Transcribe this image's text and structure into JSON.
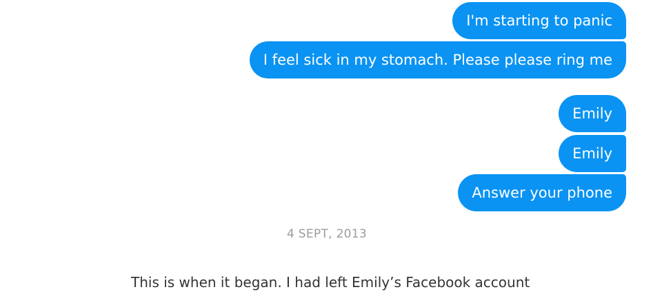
{
  "messages": [
    {
      "text": "I'm starting to panic"
    },
    {
      "text": "I feel sick in my stomach. Please please ring me"
    },
    {
      "text": "Emily"
    },
    {
      "text": "Emily"
    },
    {
      "text": "Answer your phone"
    }
  ],
  "timestamp": "4 SEPT, 2013",
  "caption": "This is when it began. I had left Emily’s Facebook account",
  "colors": {
    "bubble_background": "#0a93f3",
    "bubble_text": "#ffffff",
    "timestamp_text": "#9b9b9b",
    "caption_text": "#333333"
  }
}
